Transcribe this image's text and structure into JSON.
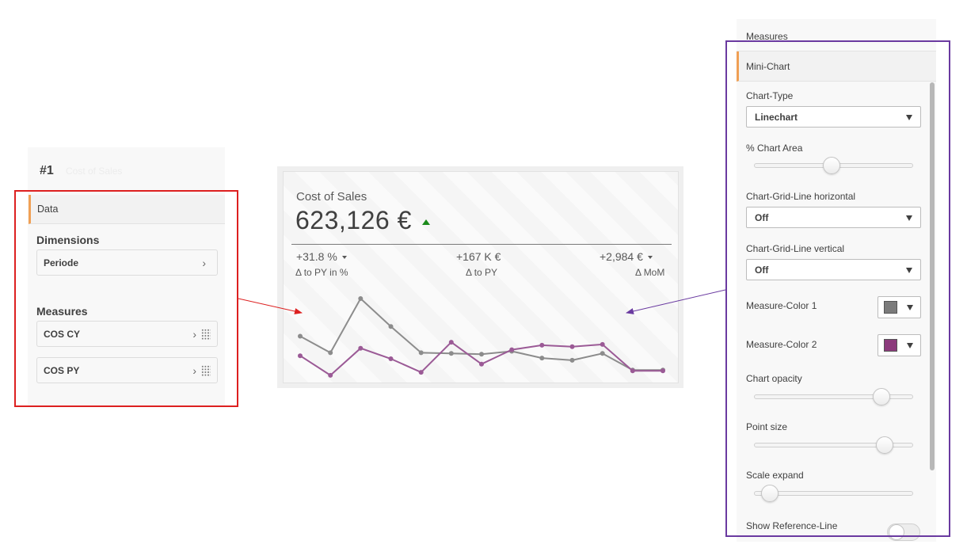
{
  "left_panel": {
    "object_number": "#1",
    "object_title": "Cost of Sales",
    "section_tab": "Data",
    "dimensions_title": "Dimensions",
    "dimensions": [
      {
        "label": "Periode"
      }
    ],
    "measures_title": "Measures",
    "measures": [
      {
        "label": "COS CY"
      },
      {
        "label": "COS PY"
      }
    ]
  },
  "kpi_card": {
    "title": "Cost of Sales",
    "value": "623,126 €",
    "trend_direction": "up",
    "trend_color": "#1a8a1a",
    "sub_kpis": [
      {
        "value": "+31.8 %",
        "label": "Δ to PY in %",
        "has_dropdown": true
      },
      {
        "value": "+167 K €",
        "label": "Δ to PY",
        "has_dropdown": false
      },
      {
        "value": "+2,984 €",
        "label": "Δ MoM",
        "has_dropdown": true
      }
    ]
  },
  "chart_data": {
    "type": "line",
    "x": [
      1,
      2,
      3,
      4,
      5,
      6,
      7,
      8,
      9,
      10,
      11,
      12,
      13
    ],
    "series": [
      {
        "color": "#8c8c8c",
        "values": [
          0.5,
          0.28,
          1.0,
          0.63,
          0.28,
          0.27,
          0.26,
          0.3,
          0.21,
          0.18,
          0.27,
          0.05,
          0.05
        ]
      },
      {
        "color": "#9b5a96",
        "values": [
          0.24,
          -0.02,
          0.34,
          0.2,
          0.02,
          0.42,
          0.13,
          0.32,
          0.38,
          0.36,
          0.39,
          0.04,
          0.04
        ]
      }
    ],
    "grid": false,
    "legend": "none"
  },
  "right_panel": {
    "measures_row": "Measures",
    "mini_chart_row": "Mini-Chart",
    "chart_type_label": "Chart-Type",
    "chart_type_value": "Linechart",
    "chart_area_label": "% Chart Area",
    "chart_area_value": 0.49,
    "grid_h_label": "Chart-Grid-Line horizontal",
    "grid_h_value": "Off",
    "grid_v_label": "Chart-Grid-Line vertical",
    "grid_v_value": "Off",
    "color1_label": "Measure-Color 1",
    "color1_value": "#7b7b7b",
    "color2_label": "Measure-Color 2",
    "color2_value": "#8c3a7c",
    "opacity_label": "Chart opacity",
    "opacity_value": 0.8,
    "point_size_label": "Point size",
    "point_size_value": 0.82,
    "scale_expand_label": "Scale expand",
    "scale_expand_value": 0.1,
    "ref_line_label": "Show Reference-Line"
  },
  "annotations": {
    "red_color": "#dd2020",
    "purple_color": "#6a3aa0"
  }
}
